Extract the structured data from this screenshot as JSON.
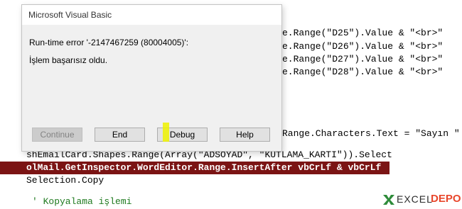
{
  "editor": {
    "lines": {
      "l1": "e.Range(\"D25\").Value & \"<br>\"",
      "l2": "e.Range(\"D26\").Value & \"<br>\"",
      "l3": "e.Range(\"D27\").Value & \"<br>\"",
      "l4": "e.Range(\"D28\").Value & \"<br>\"",
      "l5": "Range.Characters.Text = \"Sayın \"",
      "l6": "shEmailCard.Shapes.Range(Array(\"ADSOYAD\", \"KUTLAMA_KARTI\")).Select",
      "l7": "olMail.GetInspector.WordEditor.Range.InsertAfter vbCrLf & vbCrLf",
      "l8": "Selection.Copy",
      "l9": "' Kopyalama işlemi"
    },
    "highlight_color": "#7b1414",
    "comment_color": "#1f7a1f"
  },
  "dialog": {
    "title": "Microsoft Visual Basic",
    "error_line": "Run-time error '-2147467259 (80004005)':",
    "message": "İşlem başarısız oldu.",
    "buttons": {
      "continue": "Continue",
      "end": "End",
      "debug": "Debug",
      "help": "Help"
    }
  },
  "logo": {
    "part1": "EXCEL",
    "part2": "DEPO",
    "icon": "excel-depo-logo-icon",
    "color_mark": "#2e8b3a",
    "color_text2": "#e8462b"
  }
}
